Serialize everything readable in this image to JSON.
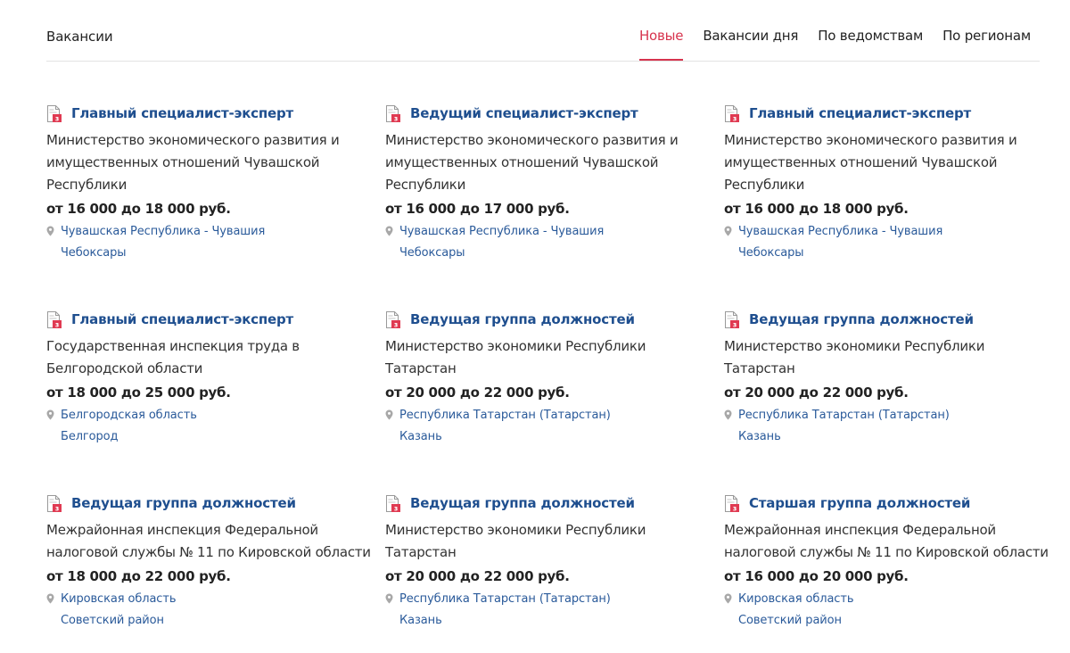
{
  "header": {
    "title": "Вакансии",
    "tabs": [
      {
        "label": "Новые",
        "active": true
      },
      {
        "label": "Вакансии дня",
        "active": false
      },
      {
        "label": "По ведомствам",
        "active": false
      },
      {
        "label": "По регионам",
        "active": false
      }
    ]
  },
  "colors": {
    "accent": "#d7344e",
    "link": "#1f4f8f"
  },
  "vacancies": [
    {
      "title": "Главный специалист-эксперт",
      "org": "Министерство экономического развития и имущественных отношений Чувашской Республики",
      "salary": "от 16 000 до 18 000 руб.",
      "region": "Чувашская Республика - Чувашия",
      "city": "Чебоксары"
    },
    {
      "title": "Ведущий специалист-эксперт",
      "org": "Министерство экономического развития и имущественных отношений Чувашской Республики",
      "salary": "от 16 000 до 17 000 руб.",
      "region": "Чувашская Республика - Чувашия",
      "city": "Чебоксары"
    },
    {
      "title": "Главный специалист-эксперт",
      "org": "Министерство экономического развития и имущественных отношений Чувашской Республики",
      "salary": "от 16 000 до 18 000 руб.",
      "region": "Чувашская Республика - Чувашия",
      "city": "Чебоксары"
    },
    {
      "title": "Главный специалист-эксперт",
      "org": "Государственная инспекция труда в Белгородской области",
      "salary": "от 18 000 до 25 000 руб.",
      "region": "Белгородская область",
      "city": "Белгород"
    },
    {
      "title": "Ведущая группа должностей",
      "org": "Министерство экономики Республики Татарстан",
      "salary": "от 20 000 до 22 000 руб.",
      "region": "Республика Татарстан (Татарстан)",
      "city": "Казань"
    },
    {
      "title": "Ведущая группа должностей",
      "org": "Министерство экономики Республики Татарстан",
      "salary": "от 20 000 до 22 000 руб.",
      "region": "Республика Татарстан (Татарстан)",
      "city": "Казань"
    },
    {
      "title": "Ведущая группа должностей",
      "org": "Межрайонная инспекция Федеральной налоговой службы № 11 по Кировской области",
      "salary": "от 18 000 до 22 000 руб.",
      "region": "Кировская область",
      "city": "Советский район"
    },
    {
      "title": "Ведущая группа должностей",
      "org": "Министерство экономики Республики Татарстан",
      "salary": "от 20 000 до 22 000 руб.",
      "region": "Республика Татарстан (Татарстан)",
      "city": "Казань"
    },
    {
      "title": "Старшая группа должностей",
      "org": "Межрайонная инспекция Федеральной налоговой службы № 11 по Кировской области",
      "salary": "от 16 000 до 20 000 руб.",
      "region": "Кировская область",
      "city": "Советский район"
    }
  ]
}
